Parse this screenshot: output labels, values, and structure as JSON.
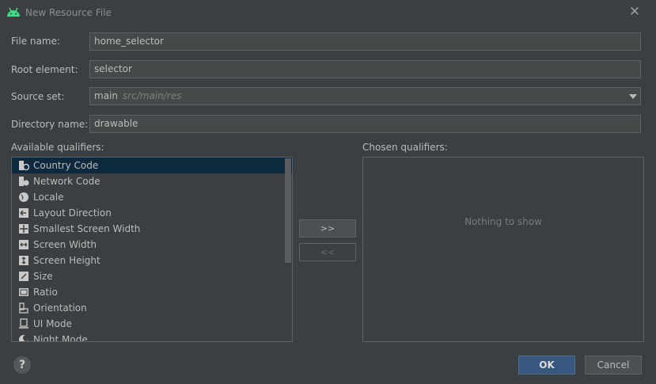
{
  "window": {
    "title": "New Resource File",
    "icon": "android-icon",
    "accent": "#3ddc84"
  },
  "form": {
    "file_name": {
      "label": "File name:",
      "value": "home_selector"
    },
    "root_element": {
      "label": "Root element:",
      "value": "selector"
    },
    "source_set": {
      "label": "Source set:",
      "value": "main",
      "hint": "src/main/res"
    },
    "directory_name": {
      "label": "Directory name:",
      "value": "drawable"
    }
  },
  "available": {
    "label": "Available qualifiers:",
    "items": [
      {
        "label": "Country Code",
        "icon": "country-code-icon",
        "selected": true
      },
      {
        "label": "Network Code",
        "icon": "network-code-icon"
      },
      {
        "label": "Locale",
        "icon": "globe-icon"
      },
      {
        "label": "Layout Direction",
        "icon": "layout-direction-icon"
      },
      {
        "label": "Smallest Screen Width",
        "icon": "smallest-width-icon"
      },
      {
        "label": "Screen Width",
        "icon": "screen-width-icon"
      },
      {
        "label": "Screen Height",
        "icon": "screen-height-icon"
      },
      {
        "label": "Size",
        "icon": "size-icon"
      },
      {
        "label": "Ratio",
        "icon": "ratio-icon"
      },
      {
        "label": "Orientation",
        "icon": "orientation-icon"
      },
      {
        "label": "UI Mode",
        "icon": "ui-mode-icon"
      },
      {
        "label": "Night Mode",
        "icon": "night-mode-icon"
      }
    ]
  },
  "transfer": {
    "add_label": ">>",
    "remove_label": "<<"
  },
  "chosen": {
    "label": "Chosen qualifiers:",
    "empty_text": "Nothing to show"
  },
  "footer": {
    "help_label": "?",
    "ok_label": "OK",
    "cancel_label": "Cancel"
  },
  "colors": {
    "background": "#3c3f41",
    "selection": "#0d293e",
    "primary_button": "#365880"
  }
}
